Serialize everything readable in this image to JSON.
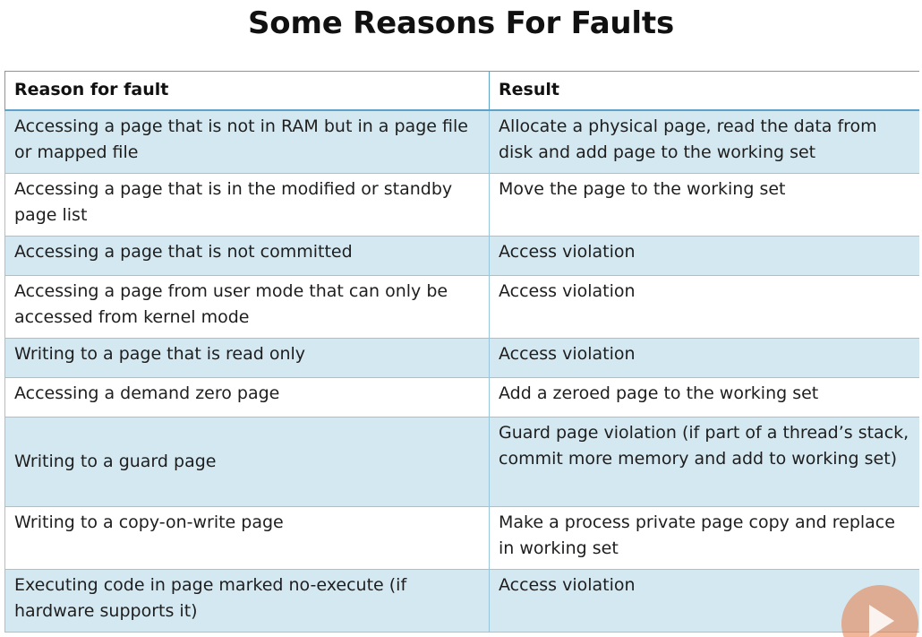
{
  "title": "Some Reasons For Faults",
  "table": {
    "headers": [
      "Reason for fault",
      "Result"
    ],
    "rows": [
      {
        "reason": "Accessing a page that is not in RAM but in a page file or mapped file",
        "result": "Allocate a physical page, read the data from disk and add page to the working set"
      },
      {
        "reason": "Accessing a page that is in the modified or standby page list",
        "result": "Move the page to the working set"
      },
      {
        "reason": "Accessing a page that is not committed",
        "result": "Access violation"
      },
      {
        "reason": "Accessing a page from user mode that can only be accessed from kernel mode",
        "result": "Access violation"
      },
      {
        "reason": "Writing to a page that is read only",
        "result": "Access violation"
      },
      {
        "reason": "Accessing a demand zero page",
        "result": "Add a zeroed page to the working set"
      },
      {
        "reason": "Writing to a guard page",
        "result": "Guard page violation (if part of a thread’s stack, commit more memory and add to working set)"
      },
      {
        "reason": "Writing to a copy-on-write page",
        "result": "Make a process private page copy and replace in working set"
      },
      {
        "reason": "Executing code in page marked no-execute (if hardware supports it)",
        "result": "Access violation"
      }
    ]
  },
  "overlay": {
    "icon": "play-icon",
    "color": "#e67846"
  }
}
